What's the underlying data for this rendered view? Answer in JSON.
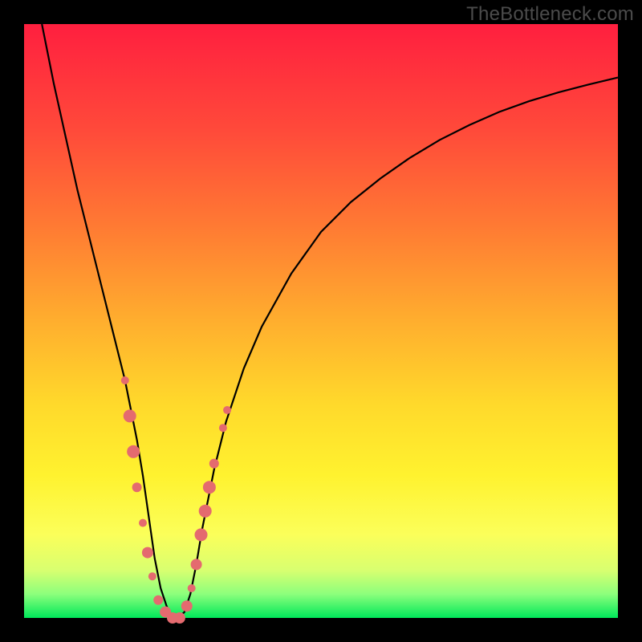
{
  "watermark": {
    "text": "TheBottleneck.com"
  },
  "colors": {
    "frame": "#000000",
    "curve_stroke": "#000000",
    "marker_fill": "#e46a6f",
    "marker_stroke": "#cc5a60"
  },
  "chart_data": {
    "type": "line",
    "title": "",
    "xlabel": "",
    "ylabel": "",
    "xlim": [
      0,
      100
    ],
    "ylim": [
      0,
      100
    ],
    "grid": false,
    "legend": false,
    "series": [
      {
        "name": "bottleneck-curve",
        "x": [
          3,
          5,
          7,
          9,
          11,
          13,
          15,
          16,
          17,
          18,
          19,
          20,
          21,
          22,
          23,
          24,
          25,
          26,
          27,
          28,
          29,
          30,
          32,
          34,
          37,
          40,
          45,
          50,
          55,
          60,
          65,
          70,
          75,
          80,
          85,
          90,
          95,
          100
        ],
        "y": [
          100,
          90,
          81,
          72,
          64,
          56,
          48,
          44,
          40,
          35,
          30,
          24,
          17,
          10,
          5,
          2,
          0,
          0,
          1,
          4,
          9,
          15,
          25,
          33,
          42,
          49,
          58,
          65,
          70,
          74,
          77.5,
          80.5,
          83,
          85.2,
          87,
          88.5,
          89.8,
          91
        ]
      }
    ],
    "markers": [
      {
        "x": 17.0,
        "y": 40,
        "r": 5
      },
      {
        "x": 17.8,
        "y": 34,
        "r": 8
      },
      {
        "x": 18.4,
        "y": 28,
        "r": 8
      },
      {
        "x": 19.0,
        "y": 22,
        "r": 6
      },
      {
        "x": 20.0,
        "y": 16,
        "r": 5
      },
      {
        "x": 20.8,
        "y": 11,
        "r": 7
      },
      {
        "x": 21.6,
        "y": 7,
        "r": 5
      },
      {
        "x": 22.6,
        "y": 3,
        "r": 6
      },
      {
        "x": 23.8,
        "y": 1,
        "r": 7
      },
      {
        "x": 25.0,
        "y": 0,
        "r": 7
      },
      {
        "x": 26.2,
        "y": 0,
        "r": 7
      },
      {
        "x": 27.4,
        "y": 2,
        "r": 7
      },
      {
        "x": 28.2,
        "y": 5,
        "r": 5
      },
      {
        "x": 29.0,
        "y": 9,
        "r": 7
      },
      {
        "x": 29.8,
        "y": 14,
        "r": 8
      },
      {
        "x": 30.5,
        "y": 18,
        "r": 8
      },
      {
        "x": 31.2,
        "y": 22,
        "r": 8
      },
      {
        "x": 32.0,
        "y": 26,
        "r": 6
      },
      {
        "x": 33.5,
        "y": 32,
        "r": 5
      },
      {
        "x": 34.2,
        "y": 35,
        "r": 5
      }
    ]
  }
}
